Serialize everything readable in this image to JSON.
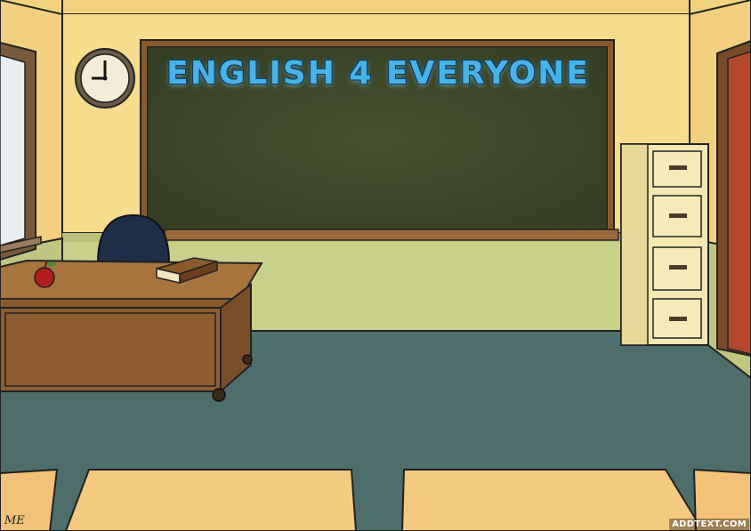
{
  "scene": {
    "board_title": "ENGLISH 4 EVERYONE",
    "watermark": "ADDTEXT.COM",
    "signature": "ME"
  },
  "colors": {
    "wall": "#f6da8c",
    "wainscot": "#c9d08a",
    "chalkboard": "#3f4a2a",
    "floor": "#4d6e6a",
    "desk": "#9a6a3a",
    "title": "#47b3e6"
  },
  "icons": [
    "clock-icon",
    "apple-icon",
    "book-icon"
  ]
}
